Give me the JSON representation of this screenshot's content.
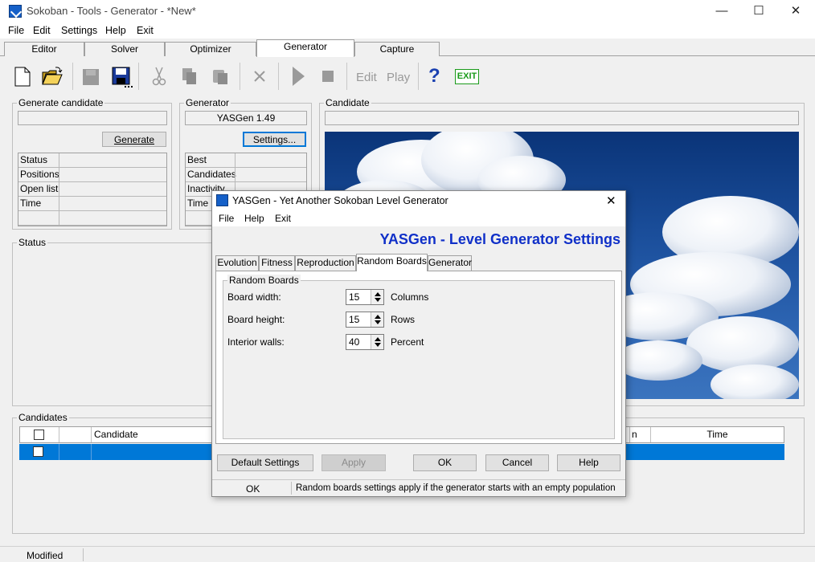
{
  "window": {
    "title": "Sokoban - Tools - Generator - *New*",
    "minimize": "—",
    "maximize": "☐",
    "close": "✕"
  },
  "menu": [
    "File",
    "Edit",
    "Settings",
    "Help",
    "Exit"
  ],
  "tabs": [
    "Editor",
    "Solver",
    "Optimizer",
    "Generator",
    "Capture"
  ],
  "active_tab": "Generator",
  "toolbar": {
    "edit_label": "Edit",
    "play_label": "Play",
    "help_glyph": "?",
    "exit_label": "EXIT",
    "icons": [
      "new-file-icon",
      "open-folder-icon",
      "disabled-save-icon",
      "save-icon",
      "cut-icon",
      "copy-icon",
      "paste-icon",
      "delete-icon",
      "play-icon",
      "stop-icon",
      "help-icon",
      "exit-icon"
    ]
  },
  "generate_candidate": {
    "title": "Generate candidate",
    "field_value": "",
    "generate_button": "Generate",
    "rows": [
      "Status",
      "Positions",
      "Open list",
      "Time",
      ""
    ]
  },
  "generator": {
    "title": "Generator",
    "name": "YASGen 1.49",
    "settings_button": "Settings...",
    "rows": [
      "Best",
      "Candidates",
      "Inactivity",
      "Time",
      ""
    ]
  },
  "candidate": {
    "title": "Candidate",
    "field_value": ""
  },
  "status_group": {
    "title": "Status"
  },
  "candidates": {
    "title": "Candidates",
    "columns": [
      "",
      "",
      "Candidate",
      "n",
      "Time"
    ]
  },
  "statusbar": {
    "text": "Modified"
  },
  "dialog": {
    "title": "YASGen - Yet Another Sokoban Level Generator",
    "close": "✕",
    "menu": [
      "File",
      "Help",
      "Exit"
    ],
    "heading": "YASGen - Level Generator Settings",
    "tabs": [
      "Evolution",
      "Fitness",
      "Reproduction",
      "Random Boards",
      "Generator"
    ],
    "active_tab": "Random Boards",
    "group_title": "Random Boards",
    "fields": [
      {
        "label": "Board width:",
        "value": "15",
        "unit": "Columns"
      },
      {
        "label": "Board height:",
        "value": "15",
        "unit": "Rows"
      },
      {
        "label": "Interior walls:",
        "value": "40",
        "unit": "Percent"
      }
    ],
    "buttons": {
      "default": "Default Settings",
      "apply": "Apply",
      "ok": "OK",
      "cancel": "Cancel",
      "help": "Help"
    },
    "status": {
      "left": "OK",
      "message": "Random boards settings apply if the generator starts with an empty population"
    }
  },
  "colors": {
    "accent": "#0078d7",
    "heading": "#1030c8",
    "exit_green": "#1a9a1a"
  }
}
